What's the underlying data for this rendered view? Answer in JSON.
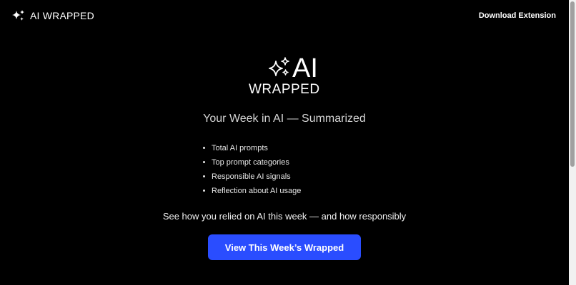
{
  "header": {
    "brand_name": "AI WRAPPED",
    "brand_icon": "sparkles-icon",
    "download_label": "Download Extension"
  },
  "hero": {
    "logo_top": "AI",
    "logo_bottom": "WRAPPED",
    "logo_icon": "sparkles-icon",
    "subtitle": "Your Week in AI — Summarized"
  },
  "features": [
    "Total AI prompts",
    "Top prompt categories",
    "Responsible AI signals",
    "Reflection about AI usage"
  ],
  "tagline": "See how you relied on AI this week — and how responsibly",
  "cta": {
    "label": "View This Week’s Wrapped"
  },
  "colors": {
    "background": "#000000",
    "text": "#ffffff",
    "accent": "#2a4dff"
  }
}
